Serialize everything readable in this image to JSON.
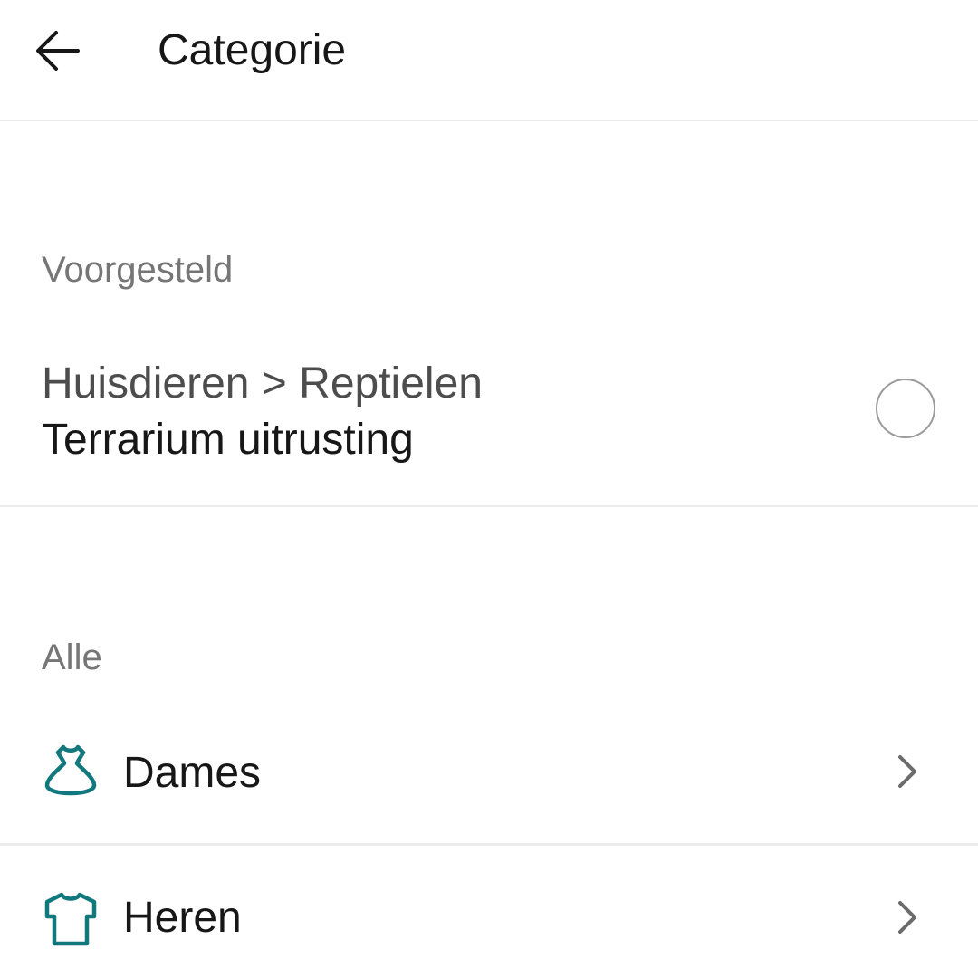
{
  "header": {
    "title": "Categorie",
    "back_icon": "arrow-left-icon"
  },
  "suggested": {
    "section_label": "Voorgesteld",
    "item": {
      "path": "Huisdieren > Reptielen",
      "name": "Terrarium uitrusting",
      "selected": false
    }
  },
  "all": {
    "section_label": "Alle",
    "items": [
      {
        "label": "Dames",
        "icon": "dress-icon",
        "icon_color": "#11797e"
      },
      {
        "label": "Heren",
        "icon": "tshirt-icon",
        "icon_color": "#11797e"
      }
    ]
  },
  "colors": {
    "text_primary": "#171717",
    "text_secondary": "#767676",
    "accent": "#11797e",
    "divider": "#ececec"
  }
}
